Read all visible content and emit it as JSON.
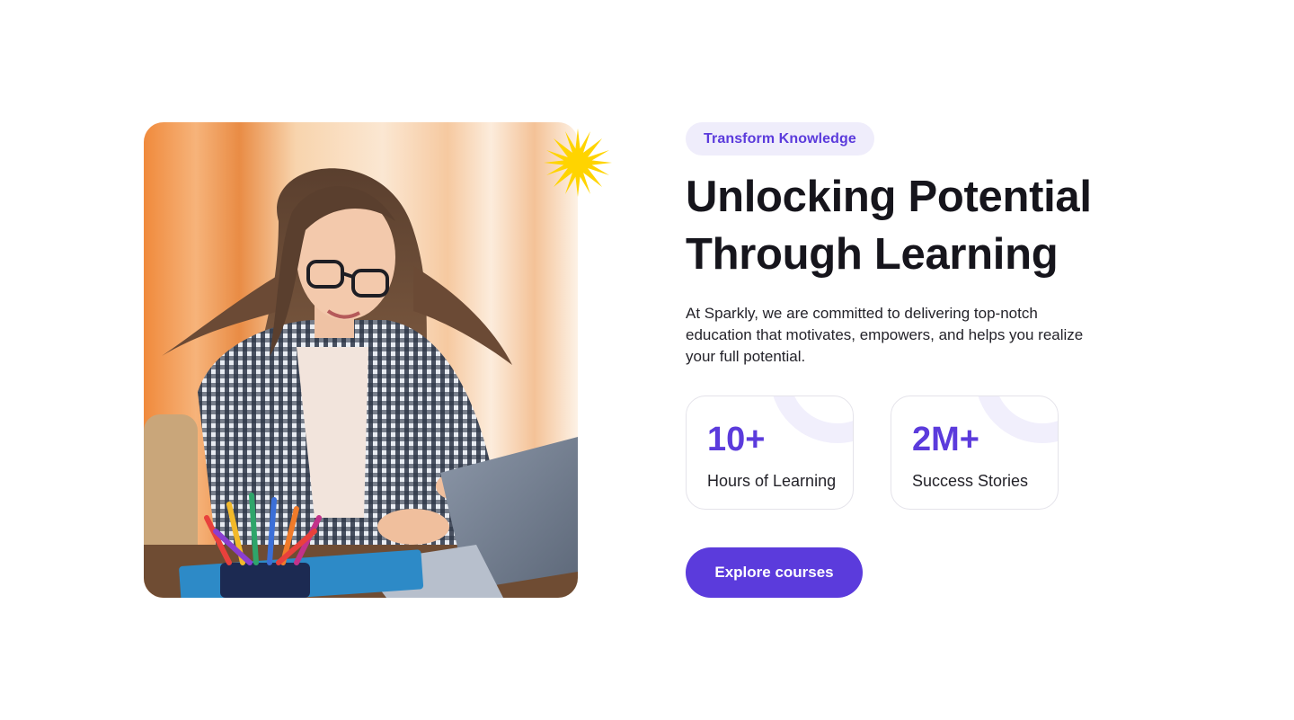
{
  "hero": {
    "tag": "Transform Knowledge",
    "headline_line1": "Unlocking Potential",
    "headline_line2": "Through Learning",
    "description": "At Sparkly, we are committed to delivering top-notch education that motivates, empowers, and helps you realize your full potential.",
    "cta_label": "Explore courses"
  },
  "stats": [
    {
      "value": "10+",
      "label": "Hours of Learning"
    },
    {
      "value": "2M+",
      "label": "Success Stories"
    }
  ],
  "image": {
    "icon": "sparkle-icon"
  },
  "colors": {
    "accent": "#5b3bdc",
    "tag_background": "#efedfb",
    "heading": "#16151c",
    "sparkle": "#ffd400"
  }
}
